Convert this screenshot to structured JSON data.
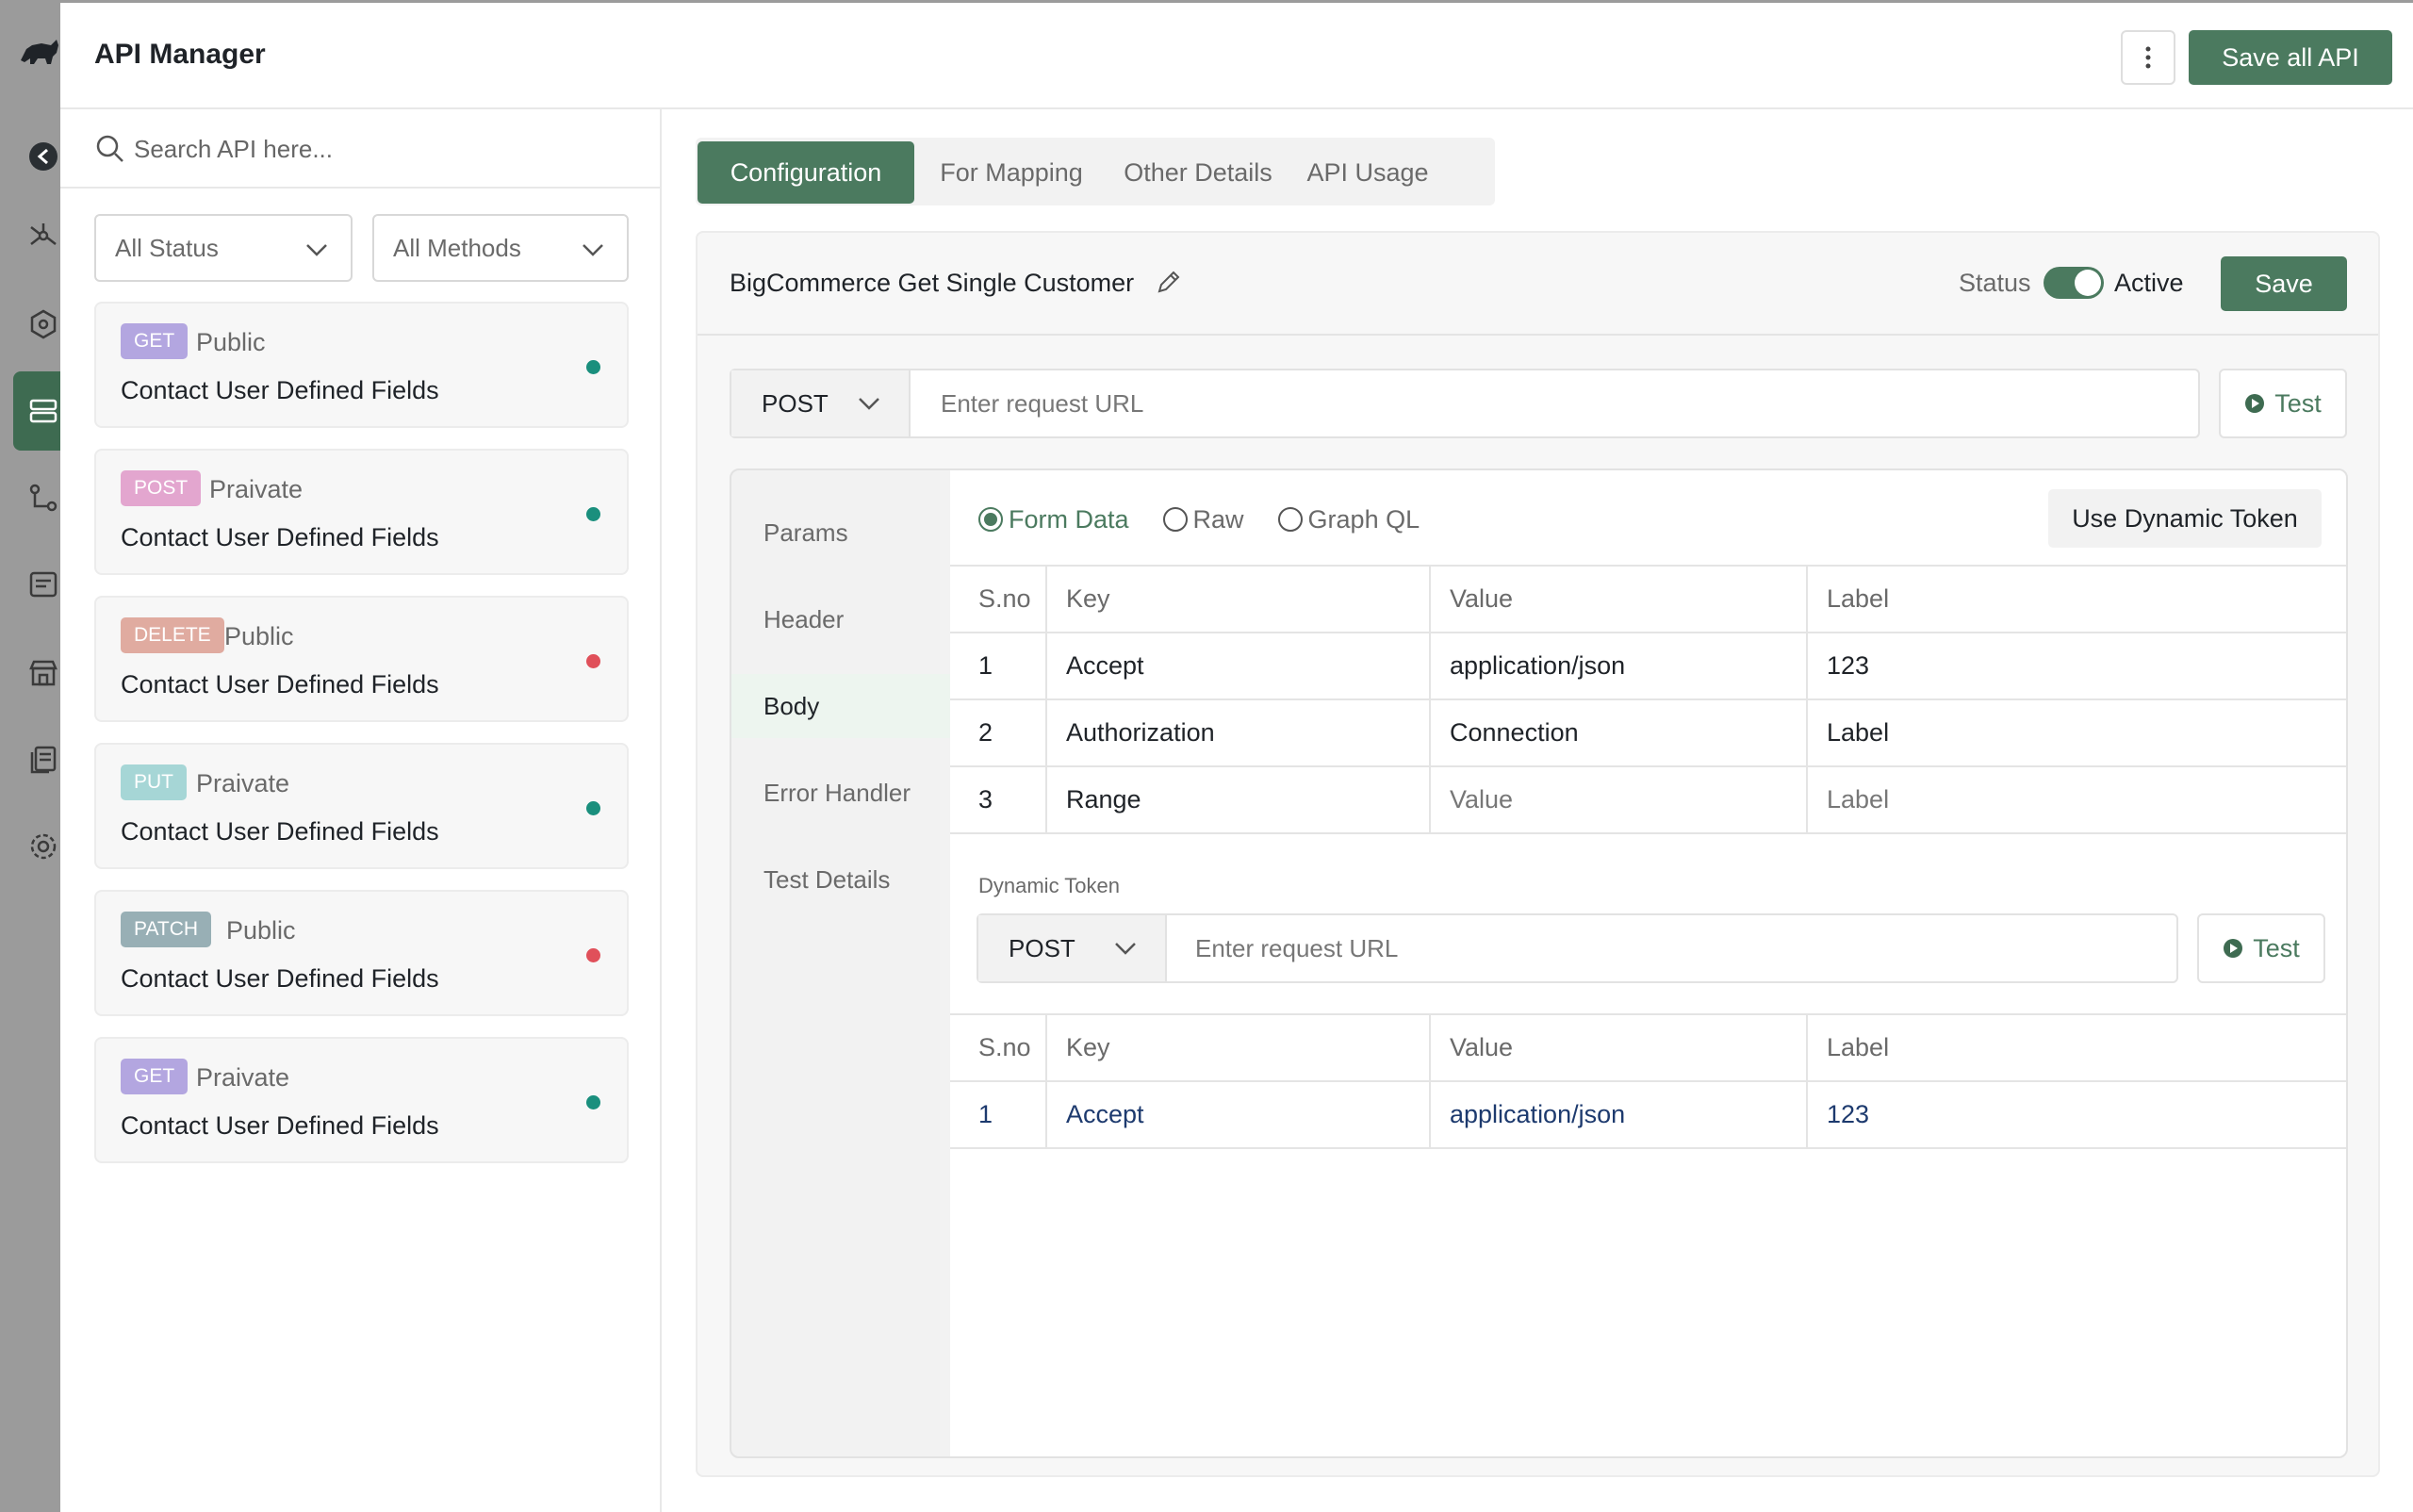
{
  "app": {
    "title": "API Manager"
  },
  "header": {
    "save_all_label": "Save all API"
  },
  "sidebar": {
    "search_placeholder": "Search API here...",
    "filters": {
      "status": "All Status",
      "methods": "All Methods"
    },
    "apis": [
      {
        "method": "GET",
        "method_color": "#b3a6e0",
        "visibility": "Public",
        "name": "Contact User Defined Fields",
        "status_color": "#1a8f7d"
      },
      {
        "method": "POST",
        "method_color": "#e3a6cf",
        "visibility": "Praivate",
        "name": "Contact User Defined Fields",
        "status_color": "#1a8f7d"
      },
      {
        "method": "DELETE",
        "method_color": "#e0aba0",
        "visibility": "Public",
        "name": "Contact User Defined Fields",
        "status_color": "#e0505a"
      },
      {
        "method": "PUT",
        "method_color": "#a6d6d6",
        "visibility": "Praivate",
        "name": "Contact User Defined Fields",
        "status_color": "#1a8f7d"
      },
      {
        "method": "PATCH",
        "method_color": "#98afb5",
        "visibility": "Public",
        "name": "Contact User Defined Fields",
        "status_color": "#e0505a"
      },
      {
        "method": "GET",
        "method_color": "#b3a6e0",
        "visibility": "Praivate",
        "name": "Contact User Defined Fields",
        "status_color": "#1a8f7d"
      }
    ]
  },
  "tabs": [
    "Configuration",
    "For Mapping",
    "Other Details",
    "API Usage"
  ],
  "active_tab": "Configuration",
  "detail": {
    "api_title": "BigCommerce Get Single Customer",
    "status_label": "Status",
    "status_value": "Active",
    "save_label": "Save",
    "request": {
      "method": "POST",
      "url_placeholder": "Enter request URL",
      "test_label": "Test"
    },
    "subnav": [
      "Params",
      "Header",
      "Body",
      "Error Handler",
      "Test Details"
    ],
    "active_subnav": "Body",
    "body_types": [
      "Form Data",
      "Raw",
      "Graph QL"
    ],
    "selected_body_type": "Form Data",
    "dynamic_token_button": "Use Dynamic Token",
    "table_headers": [
      "S.no",
      "Key",
      "Value",
      "Label"
    ],
    "rows": [
      {
        "sno": "1",
        "key": "Accept",
        "value": "application/json",
        "label": "123"
      },
      {
        "sno": "2",
        "key": "Authorization",
        "value": "Connection",
        "label": "Label"
      },
      {
        "sno": "3",
        "key": "Range",
        "value": "Value",
        "label": "Label"
      }
    ],
    "dynamic_token": {
      "label": "Dynamic Token",
      "method": "POST",
      "url_placeholder": "Enter request URL",
      "test_label": "Test",
      "rows": [
        {
          "sno": "1",
          "key": "Accept",
          "value": "application/json",
          "label": "123"
        }
      ]
    }
  },
  "colors": {
    "accent": "#4b7a5f",
    "active_dot": "#1a8f7d",
    "inactive_dot": "#e0505a"
  }
}
